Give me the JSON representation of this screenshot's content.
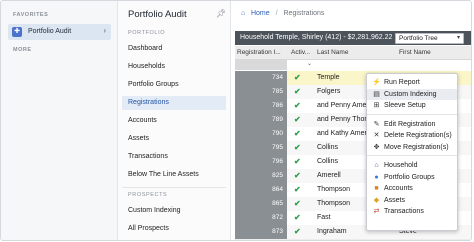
{
  "sidebar": {
    "favorites_label": "FAVORITES",
    "favorite_item": "Portfolio Audit",
    "more_label": "MORE"
  },
  "nav": {
    "title": "Portfolio Audit",
    "section_portfolio": "PORTFOLIO",
    "items": [
      "Dashboard",
      "Households",
      "Portfolio Groups",
      "Registrations",
      "Accounts",
      "Assets",
      "Transactions",
      "Below The Line Assets"
    ],
    "selected": "Registrations",
    "section_prospects": "PROSPECTS",
    "prospect_items": [
      "Custom Indexing",
      "All Prospects"
    ]
  },
  "breadcrumb": {
    "home": "Home",
    "current": "Registrations"
  },
  "household_bar": {
    "text": "Household Temple, Shirley (412) - $2,281,962.22",
    "select_value": "Portfolio Tree"
  },
  "table": {
    "headers": [
      "Registration I...",
      "Activ...",
      "Last Name",
      "First Name"
    ],
    "rows": [
      {
        "id": "734",
        "last": "Temple",
        "first": ""
      },
      {
        "id": "785",
        "last": "Folgers",
        "first": ""
      },
      {
        "id": "786",
        "last": "and Penny Amer",
        "first": ""
      },
      {
        "id": "789",
        "last": "and Penny Thon",
        "first": ""
      },
      {
        "id": "790",
        "last": "and Kathy Amer",
        "first": ""
      },
      {
        "id": "795",
        "last": "Collins",
        "first": ""
      },
      {
        "id": "796",
        "last": "Collins",
        "first": ""
      },
      {
        "id": "825",
        "last": "Amerell",
        "first": ""
      },
      {
        "id": "864",
        "last": "Thompson",
        "first": ""
      },
      {
        "id": "865",
        "last": "Thompson",
        "first": ""
      },
      {
        "id": "872",
        "last": "Fast",
        "first": ""
      },
      {
        "id": "873",
        "last": "Ingraham",
        "first": "Steve"
      }
    ]
  },
  "context_menu": {
    "groups": [
      [
        {
          "label": "Run Report",
          "icon": "bolt-icon",
          "glyph": "⚡",
          "color": "#333333"
        },
        {
          "label": "Custom Indexing",
          "icon": "sliders-icon",
          "glyph": "▤",
          "color": "#333333"
        },
        {
          "label": "Sleeve Setup",
          "icon": "sitemap-icon",
          "glyph": "⊞",
          "color": "#333333"
        }
      ],
      [
        {
          "label": "Edit Registration",
          "icon": "edit-icon",
          "glyph": "✎",
          "color": "#333333"
        },
        {
          "label": "Delete Registration(s)",
          "icon": "delete-icon",
          "glyph": "✕",
          "color": "#333333"
        },
        {
          "label": "Move Registration(s)",
          "icon": "move-icon",
          "glyph": "✥",
          "color": "#333333"
        }
      ],
      [
        {
          "label": "Household",
          "icon": "house-icon",
          "glyph": "⌂",
          "color": "#6b3fa0"
        },
        {
          "label": "Portfolio Groups",
          "icon": "group-icon",
          "glyph": "●",
          "color": "#2e7bd6"
        },
        {
          "label": "Accounts",
          "icon": "briefcase-icon",
          "glyph": "■",
          "color": "#d9822b"
        },
        {
          "label": "Assets",
          "icon": "tag-icon",
          "glyph": "◆",
          "color": "#e0a020"
        },
        {
          "label": "Transactions",
          "icon": "exchange-icon",
          "glyph": "⇄",
          "color": "#c0392b"
        }
      ]
    ]
  },
  "colors": {
    "accent": "#2255a4",
    "check": "#2aa04a",
    "highlight_row": "#fbf6c9"
  }
}
